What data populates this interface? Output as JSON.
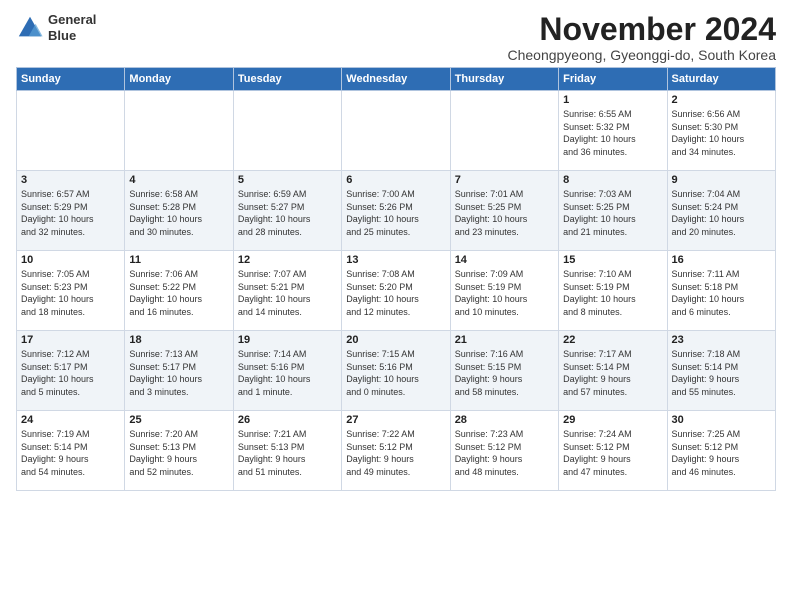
{
  "logo": {
    "general": "General",
    "blue": "Blue"
  },
  "title": "November 2024",
  "location": "Cheongpyeong, Gyeonggi-do, South Korea",
  "days_of_week": [
    "Sunday",
    "Monday",
    "Tuesday",
    "Wednesday",
    "Thursday",
    "Friday",
    "Saturday"
  ],
  "weeks": [
    [
      {
        "day": "",
        "info": ""
      },
      {
        "day": "",
        "info": ""
      },
      {
        "day": "",
        "info": ""
      },
      {
        "day": "",
        "info": ""
      },
      {
        "day": "",
        "info": ""
      },
      {
        "day": "1",
        "info": "Sunrise: 6:55 AM\nSunset: 5:32 PM\nDaylight: 10 hours\nand 36 minutes."
      },
      {
        "day": "2",
        "info": "Sunrise: 6:56 AM\nSunset: 5:30 PM\nDaylight: 10 hours\nand 34 minutes."
      }
    ],
    [
      {
        "day": "3",
        "info": "Sunrise: 6:57 AM\nSunset: 5:29 PM\nDaylight: 10 hours\nand 32 minutes."
      },
      {
        "day": "4",
        "info": "Sunrise: 6:58 AM\nSunset: 5:28 PM\nDaylight: 10 hours\nand 30 minutes."
      },
      {
        "day": "5",
        "info": "Sunrise: 6:59 AM\nSunset: 5:27 PM\nDaylight: 10 hours\nand 28 minutes."
      },
      {
        "day": "6",
        "info": "Sunrise: 7:00 AM\nSunset: 5:26 PM\nDaylight: 10 hours\nand 25 minutes."
      },
      {
        "day": "7",
        "info": "Sunrise: 7:01 AM\nSunset: 5:25 PM\nDaylight: 10 hours\nand 23 minutes."
      },
      {
        "day": "8",
        "info": "Sunrise: 7:03 AM\nSunset: 5:25 PM\nDaylight: 10 hours\nand 21 minutes."
      },
      {
        "day": "9",
        "info": "Sunrise: 7:04 AM\nSunset: 5:24 PM\nDaylight: 10 hours\nand 20 minutes."
      }
    ],
    [
      {
        "day": "10",
        "info": "Sunrise: 7:05 AM\nSunset: 5:23 PM\nDaylight: 10 hours\nand 18 minutes."
      },
      {
        "day": "11",
        "info": "Sunrise: 7:06 AM\nSunset: 5:22 PM\nDaylight: 10 hours\nand 16 minutes."
      },
      {
        "day": "12",
        "info": "Sunrise: 7:07 AM\nSunset: 5:21 PM\nDaylight: 10 hours\nand 14 minutes."
      },
      {
        "day": "13",
        "info": "Sunrise: 7:08 AM\nSunset: 5:20 PM\nDaylight: 10 hours\nand 12 minutes."
      },
      {
        "day": "14",
        "info": "Sunrise: 7:09 AM\nSunset: 5:19 PM\nDaylight: 10 hours\nand 10 minutes."
      },
      {
        "day": "15",
        "info": "Sunrise: 7:10 AM\nSunset: 5:19 PM\nDaylight: 10 hours\nand 8 minutes."
      },
      {
        "day": "16",
        "info": "Sunrise: 7:11 AM\nSunset: 5:18 PM\nDaylight: 10 hours\nand 6 minutes."
      }
    ],
    [
      {
        "day": "17",
        "info": "Sunrise: 7:12 AM\nSunset: 5:17 PM\nDaylight: 10 hours\nand 5 minutes."
      },
      {
        "day": "18",
        "info": "Sunrise: 7:13 AM\nSunset: 5:17 PM\nDaylight: 10 hours\nand 3 minutes."
      },
      {
        "day": "19",
        "info": "Sunrise: 7:14 AM\nSunset: 5:16 PM\nDaylight: 10 hours\nand 1 minute."
      },
      {
        "day": "20",
        "info": "Sunrise: 7:15 AM\nSunset: 5:16 PM\nDaylight: 10 hours\nand 0 minutes."
      },
      {
        "day": "21",
        "info": "Sunrise: 7:16 AM\nSunset: 5:15 PM\nDaylight: 9 hours\nand 58 minutes."
      },
      {
        "day": "22",
        "info": "Sunrise: 7:17 AM\nSunset: 5:14 PM\nDaylight: 9 hours\nand 57 minutes."
      },
      {
        "day": "23",
        "info": "Sunrise: 7:18 AM\nSunset: 5:14 PM\nDaylight: 9 hours\nand 55 minutes."
      }
    ],
    [
      {
        "day": "24",
        "info": "Sunrise: 7:19 AM\nSunset: 5:14 PM\nDaylight: 9 hours\nand 54 minutes."
      },
      {
        "day": "25",
        "info": "Sunrise: 7:20 AM\nSunset: 5:13 PM\nDaylight: 9 hours\nand 52 minutes."
      },
      {
        "day": "26",
        "info": "Sunrise: 7:21 AM\nSunset: 5:13 PM\nDaylight: 9 hours\nand 51 minutes."
      },
      {
        "day": "27",
        "info": "Sunrise: 7:22 AM\nSunset: 5:12 PM\nDaylight: 9 hours\nand 49 minutes."
      },
      {
        "day": "28",
        "info": "Sunrise: 7:23 AM\nSunset: 5:12 PM\nDaylight: 9 hours\nand 48 minutes."
      },
      {
        "day": "29",
        "info": "Sunrise: 7:24 AM\nSunset: 5:12 PM\nDaylight: 9 hours\nand 47 minutes."
      },
      {
        "day": "30",
        "info": "Sunrise: 7:25 AM\nSunset: 5:12 PM\nDaylight: 9 hours\nand 46 minutes."
      }
    ]
  ]
}
